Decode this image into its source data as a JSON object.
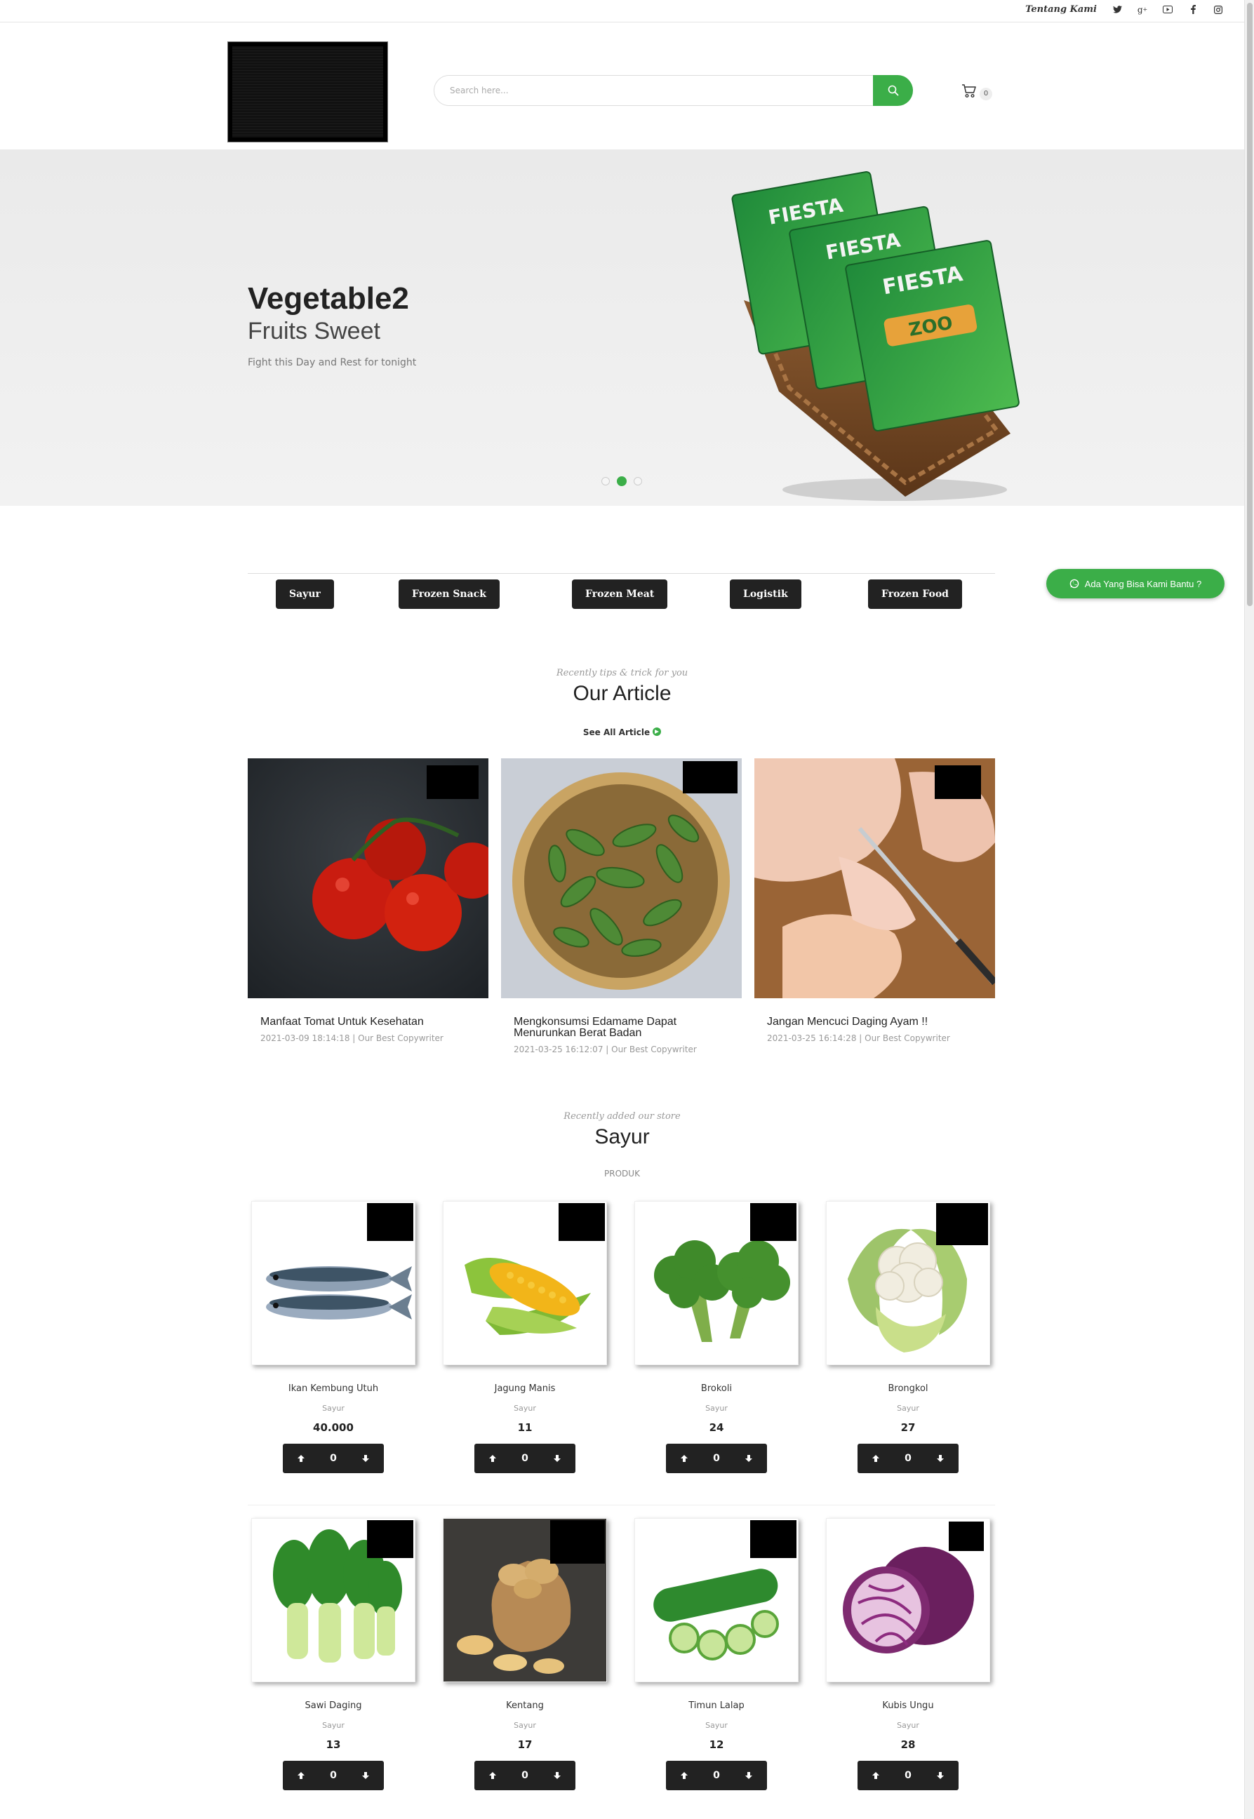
{
  "topbar": {
    "about_label": "Tentang Kami",
    "social_icons": [
      "twitter-icon",
      "google-plus-icon",
      "youtube-icon",
      "facebook-icon",
      "instagram-icon"
    ]
  },
  "header": {
    "search_placeholder": "Search here...",
    "cart_count": "0"
  },
  "hero": {
    "title": "Vegetable2",
    "subtitle": "Fruits Sweet",
    "description": "Fight this Day and Rest for tonight",
    "image_text": "FIESTA",
    "image_text_2": "ZOO"
  },
  "categories": [
    "Sayur",
    "Frozen Snack",
    "Frozen Meat",
    "Logistik",
    "Frozen Food"
  ],
  "whatsapp": {
    "label": "Ada Yang Bisa Kami Bantu ?"
  },
  "articles_section": {
    "eyebrow": "Recently tips & trick for you",
    "title": "Our Article",
    "see_all": "See All Article",
    "items": [
      {
        "title": "Manfaat Tomat Untuk Kesehatan",
        "meta": "2021-03-09 18:14:18 | Our Best Copywriter"
      },
      {
        "title": "Mengkonsumsi Edamame Dapat Menurunkan Berat Badan",
        "meta": "2021-03-25 16:12:07 | Our Best Copywriter"
      },
      {
        "title": "Jangan Mencuci Daging Ayam !!",
        "meta": "2021-03-25 16:14:28 | Our Best Copywriter"
      }
    ]
  },
  "products_section": {
    "eyebrow": "Recently added our store",
    "title": "Sayur",
    "label": "PRODUK",
    "items": [
      {
        "name": "Ikan Kembung Utuh",
        "category": "Sayur",
        "price": "40.000",
        "qty": "0"
      },
      {
        "name": "Jagung Manis",
        "category": "Sayur",
        "price": "11",
        "qty": "0"
      },
      {
        "name": "Brokoli",
        "category": "Sayur",
        "price": "24",
        "qty": "0"
      },
      {
        "name": "Brongkol",
        "category": "Sayur",
        "price": "27",
        "qty": "0"
      },
      {
        "name": "Sawi Daging",
        "category": "Sayur",
        "price": "13",
        "qty": "0"
      },
      {
        "name": "Kentang",
        "category": "Sayur",
        "price": "17",
        "qty": "0"
      },
      {
        "name": "Timun Lalap",
        "category": "Sayur",
        "price": "12",
        "qty": "0"
      },
      {
        "name": "Kubis Ungu",
        "category": "Sayur",
        "price": "28",
        "qty": "0"
      }
    ]
  },
  "colors": {
    "accent": "#3bae48",
    "dark": "#222222"
  }
}
